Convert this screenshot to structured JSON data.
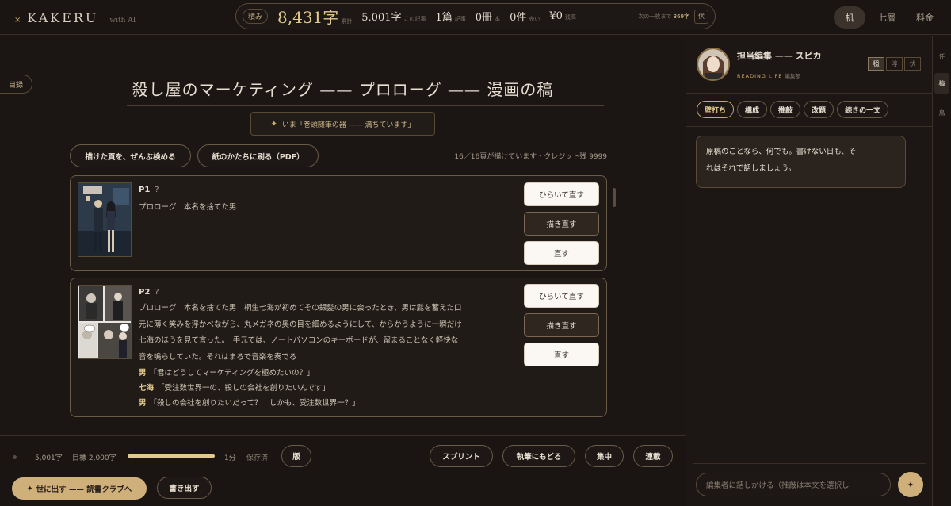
{
  "brand": {
    "mark": "×",
    "name": "KAKERU",
    "suffix": "with AI"
  },
  "stats": {
    "label": "積み",
    "total_chars": "8,431字",
    "total_unit": "累計",
    "article_chars": "5,001字",
    "article_unit": "この記事",
    "chapters": "1篇",
    "chapters_unit": "記事",
    "books": "0冊",
    "books_unit": "本",
    "items": "0件",
    "items_unit": "売い",
    "balance": "¥0",
    "balance_unit": "残高",
    "next_prefix": "次の一枚まで",
    "next_value": "369字",
    "box_label": "伏"
  },
  "topnav": [
    {
      "label": "机",
      "active": true
    },
    {
      "label": "七層",
      "active": false
    },
    {
      "label": "料金",
      "active": false
    }
  ],
  "toc_label": "目録",
  "main": {
    "title": "殺し屋のマーケティング —— プロローグ —— 漫画の稿",
    "status_chip": "いま「巻頭随筆の器 —— 満ちています」",
    "review_all_button": "描けた頁を、ぜんぶ検める",
    "print_pdf_button": "紙のかたちに刷る（PDF）",
    "credit_status": "16／16頁が描けています・クレジット残 9999"
  },
  "pages": [
    {
      "no": "P1",
      "q": "?",
      "body": [
        "プロローグ　本名を捨てた男"
      ],
      "dialogue": [],
      "buttons": [
        "ひらいて直す",
        "描き直す",
        "直す"
      ]
    },
    {
      "no": "P2",
      "q": "?",
      "body": [
        "プロローグ　本名を捨てた男　桐生七海が初めてその銀髪の男に会ったとき、男は髭を蓄えた口",
        "元に薄く笑みを浮かべながら、丸メガネの奥の目を細めるようにして、からかうように一瞬だけ",
        "七海のほうを見て言った。　手元では、ノートパソコンのキーボードが、留まることなく軽快な",
        "音を鳴らしていた。それはまるで音楽を奏でる"
      ],
      "dialogue": [
        {
          "speaker": "男",
          "line": "「君はどうしてマーケティングを極めたいの？」"
        },
        {
          "speaker": "七海",
          "line": "「受注数世界一の、殺しの会社を創りたいんです」"
        },
        {
          "speaker": "男",
          "line": "「殺しの会社を創りたいだって？　しかも、受注数世界一？」"
        }
      ],
      "buttons": [
        "ひらいて直す",
        "描き直す",
        "直す"
      ]
    }
  ],
  "bottombar": {
    "char_count": "5,001字",
    "goal": "目標 2,000字",
    "progress": 1.0,
    "minutes": "1分",
    "saved": "保存済",
    "edition_button": "版",
    "sprint_button": "スプリント",
    "back_button": "執筆にもどる",
    "focus_button": "集中",
    "serial_button": "連載",
    "publish_button": "世に出す —— 読書クラブへ",
    "export_button": "書き出す"
  },
  "editor_panel": {
    "name": "担当編集 —— スピカ",
    "sub_en": "READING LIFE",
    "sub_jp": "編集部",
    "moods": [
      {
        "label": "穏",
        "active": true
      },
      {
        "label": "淳",
        "active": false
      },
      {
        "label": "伏",
        "active": false
      }
    ],
    "tabs": [
      {
        "label": "壁打ち",
        "active": true
      },
      {
        "label": "構成",
        "active": false
      },
      {
        "label": "推敲",
        "active": false
      },
      {
        "label": "改題",
        "active": false
      },
      {
        "label": "続きの一文",
        "active": false
      }
    ],
    "message_lines": [
      "原稿のことなら、何でも。書けない日も、そ",
      "れはそれで話しましょう。"
    ],
    "input_placeholder": "編集者に話しかける（推敲は本文を選択し"
  },
  "rail": [
    {
      "label": "任",
      "active": false
    },
    {
      "label": "稿",
      "active": true
    },
    {
      "label": "鳥",
      "active": false
    }
  ],
  "colors": {
    "accent_gold": "#cfb07a",
    "background": "#1b1614",
    "panel": "#1c1714"
  }
}
